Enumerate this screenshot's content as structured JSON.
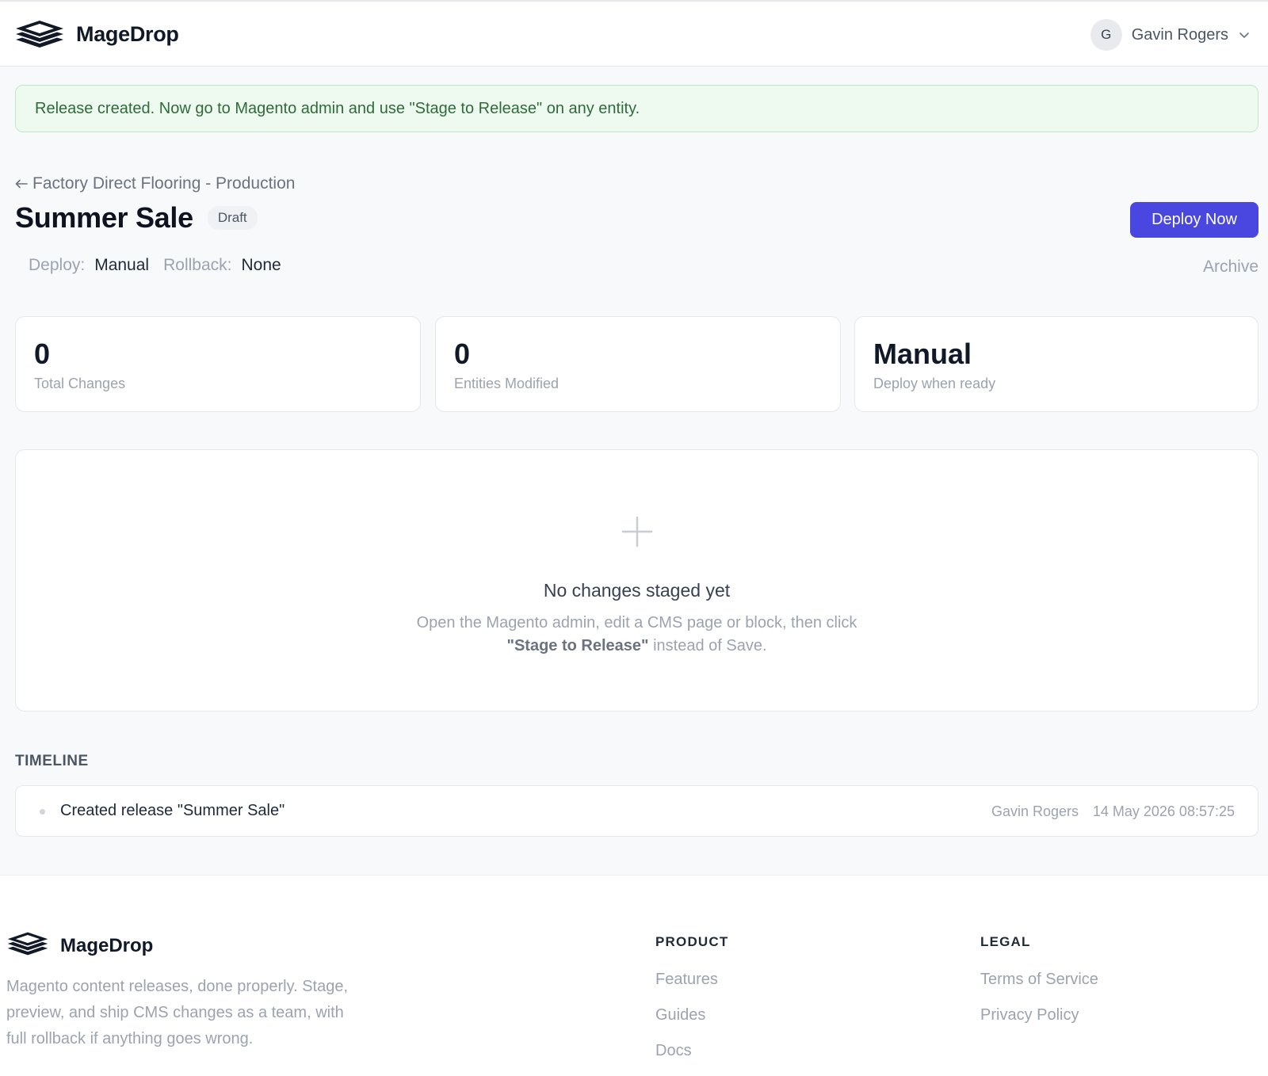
{
  "header": {
    "brand": "MageDrop",
    "user": {
      "initial": "G",
      "name": "Gavin Rogers"
    }
  },
  "alert": {
    "message": "Release created. Now go to Magento admin and use \"Stage to Release\" on any entity."
  },
  "page": {
    "back_label": "Factory Direct Flooring - Production",
    "title": "Summer Sale",
    "status_badge": "Draft",
    "deploy_button": "Deploy Now",
    "archive_label": "Archive",
    "meta": {
      "deploy_key": "Deploy:",
      "deploy_value": "Manual",
      "rollback_key": "Rollback:",
      "rollback_value": "None"
    }
  },
  "stats": [
    {
      "value": "0",
      "label": "Total Changes"
    },
    {
      "value": "0",
      "label": "Entities Modified"
    },
    {
      "value": "Manual",
      "label": "Deploy when ready"
    }
  ],
  "empty_state": {
    "title": "No changes staged yet",
    "line1": "Open the Magento admin, edit a CMS page or block, then click",
    "emph": "\"Stage to Release\"",
    "line2_rest": " instead of Save."
  },
  "timeline": {
    "heading": "TIMELINE",
    "items": [
      {
        "event": "Created release \"Summer Sale\"",
        "user": "Gavin Rogers",
        "timestamp": "14 May 2026 08:57:25"
      }
    ]
  },
  "footer": {
    "brand": "MageDrop",
    "tagline": "Magento content releases, done properly. Stage, preview, and ship CMS changes as a team, with full rollback if anything goes wrong.",
    "columns": [
      {
        "heading": "PRODUCT",
        "links": [
          "Features",
          "Guides",
          "Docs"
        ]
      },
      {
        "heading": "LEGAL",
        "links": [
          "Terms of Service",
          "Privacy Policy"
        ]
      }
    ]
  },
  "colors": {
    "primary": "#4a46e0",
    "success_bg": "#eefaf0",
    "success_text": "#2f6b3a"
  }
}
